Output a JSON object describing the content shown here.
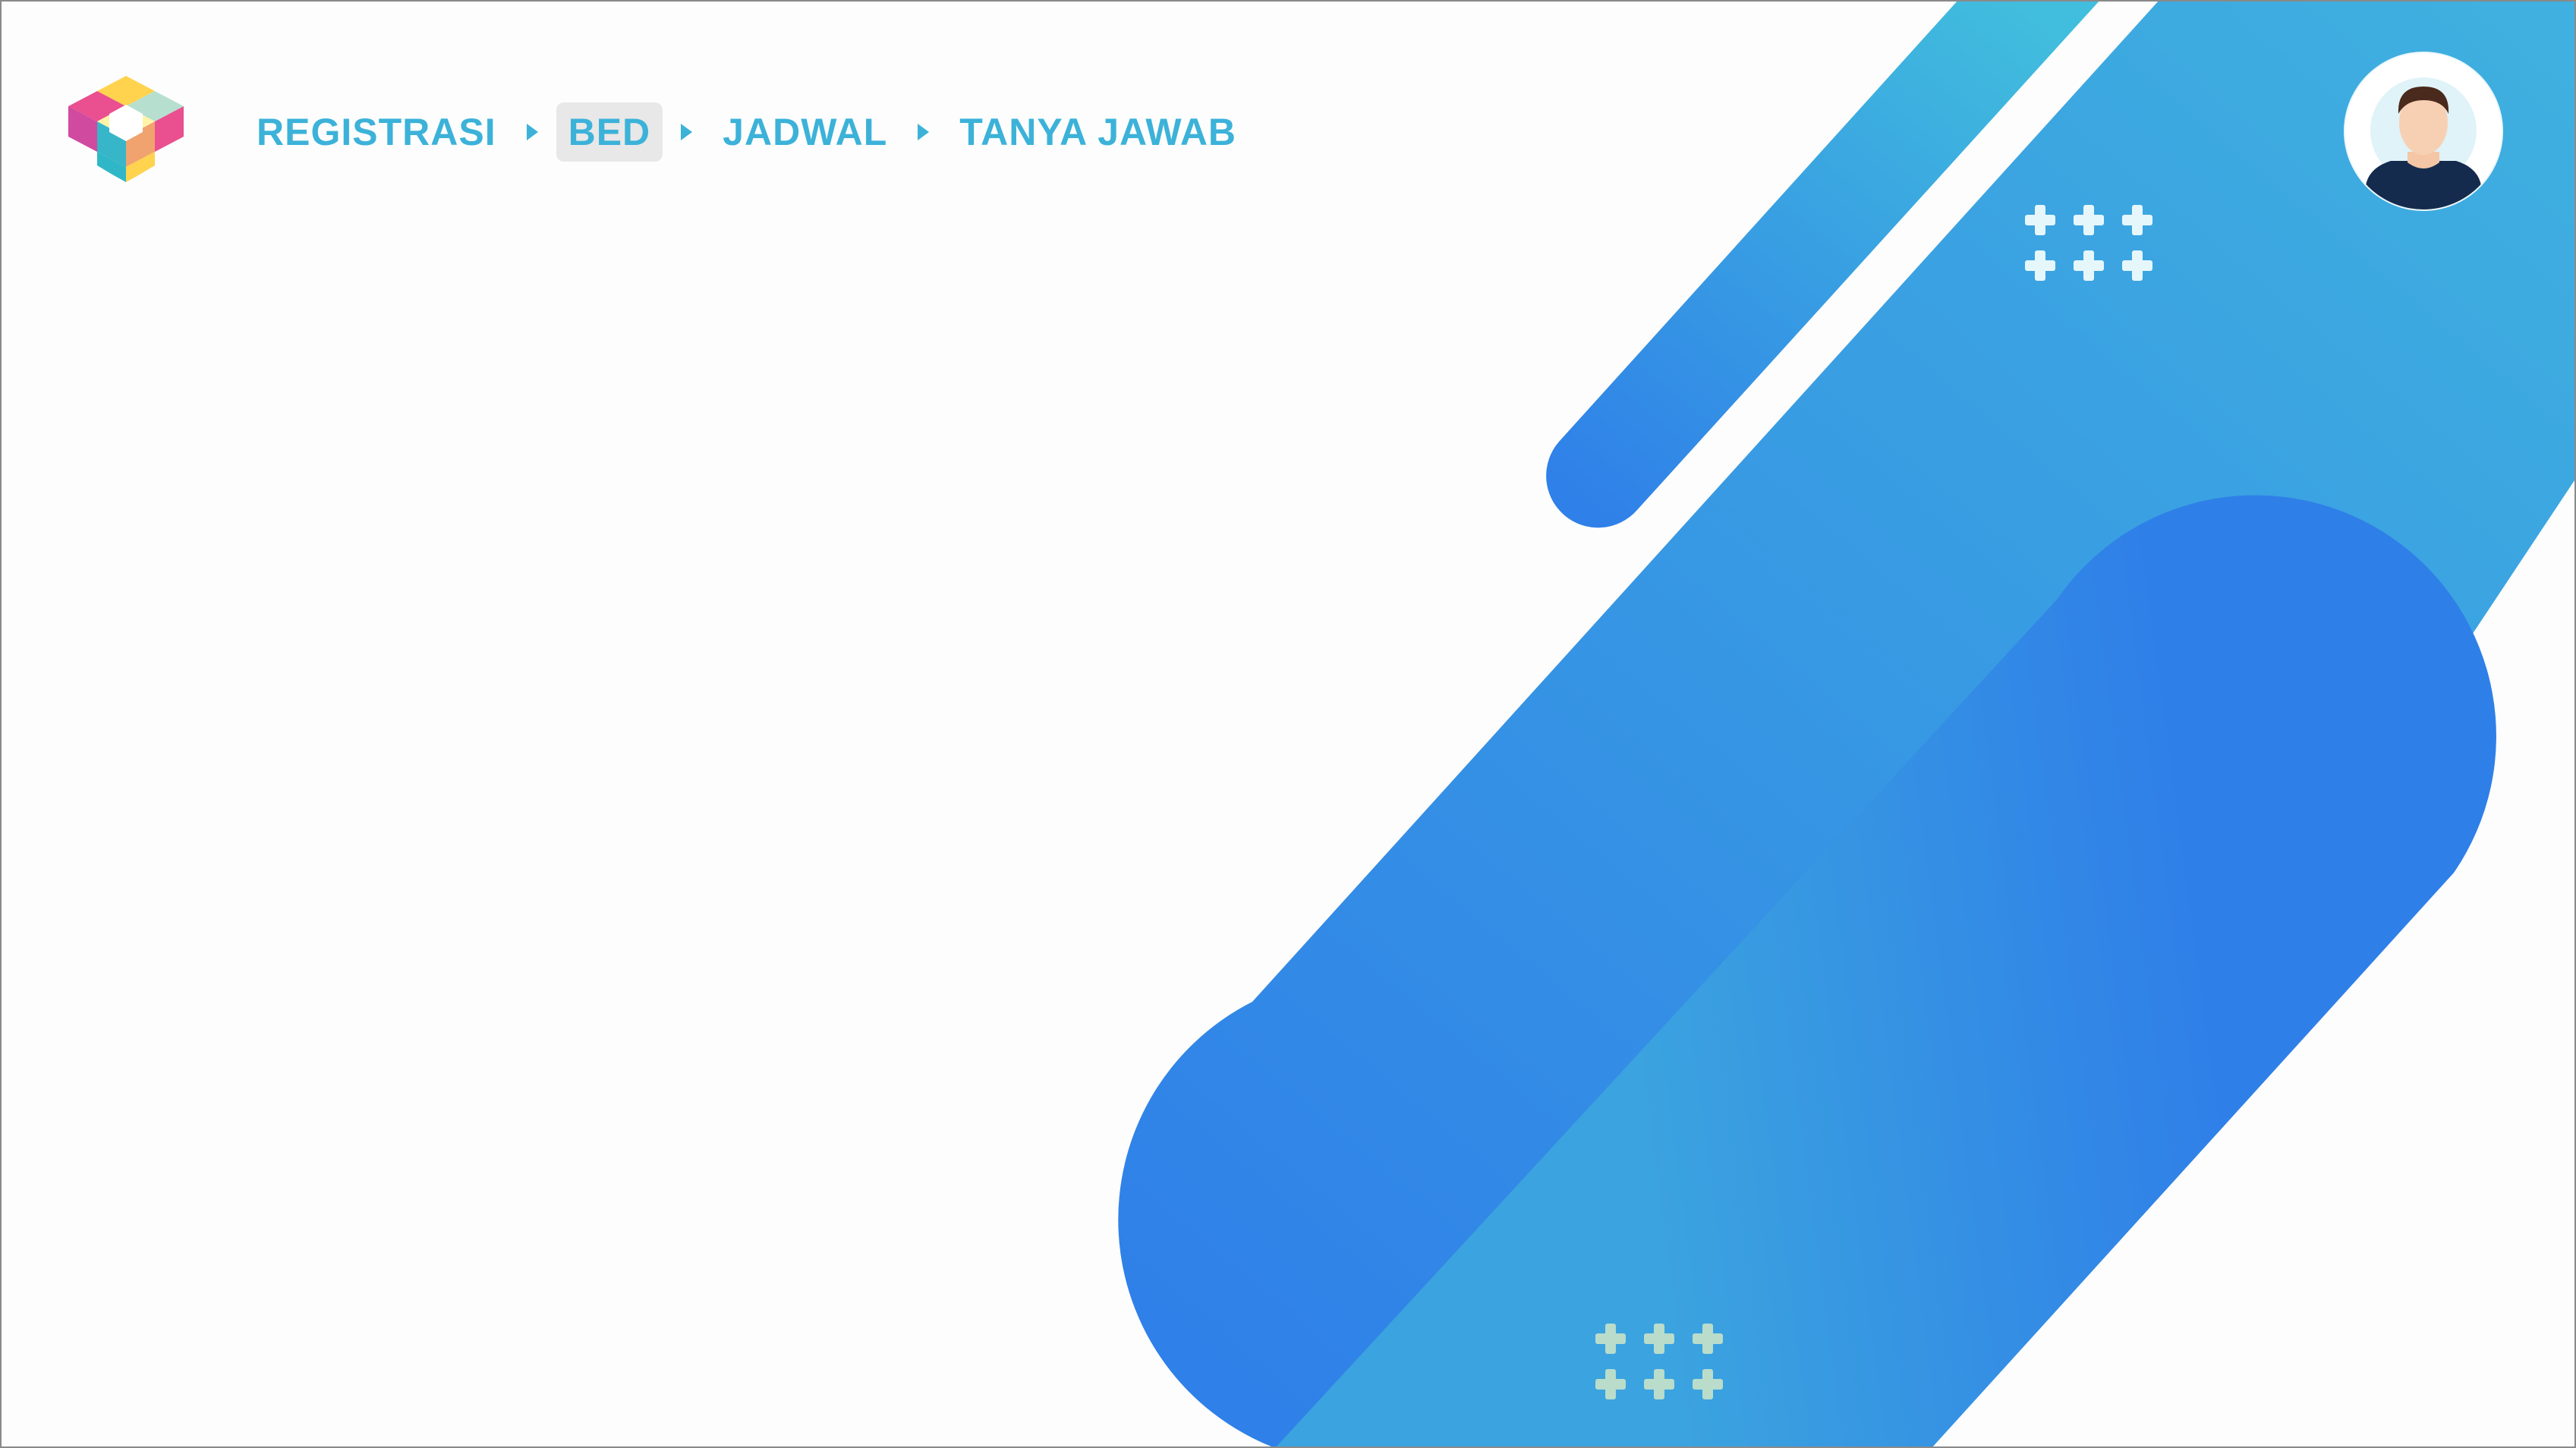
{
  "colors": {
    "accent": "#3cb2d9",
    "blue_light": "#41b9dd",
    "blue_mid": "#3a9ee0",
    "blue_deep": "#2f7fe8",
    "plus_white": "#e6f7fc",
    "plus_mint": "#b9dccb"
  },
  "header": {
    "logo_icon": "hexagon-cube-logo",
    "breadcrumb": [
      {
        "label": "REGISTRASI",
        "active": false
      },
      {
        "label": "BED",
        "active": true
      },
      {
        "label": "JADWAL",
        "active": false
      },
      {
        "label": "TANYA JAWAB",
        "active": false
      }
    ],
    "separator_icon": "triangle-right-icon",
    "avatar_icon": "user-avatar-icon"
  },
  "decor": {
    "plus_pattern_icon": "plus-pattern-icon"
  }
}
